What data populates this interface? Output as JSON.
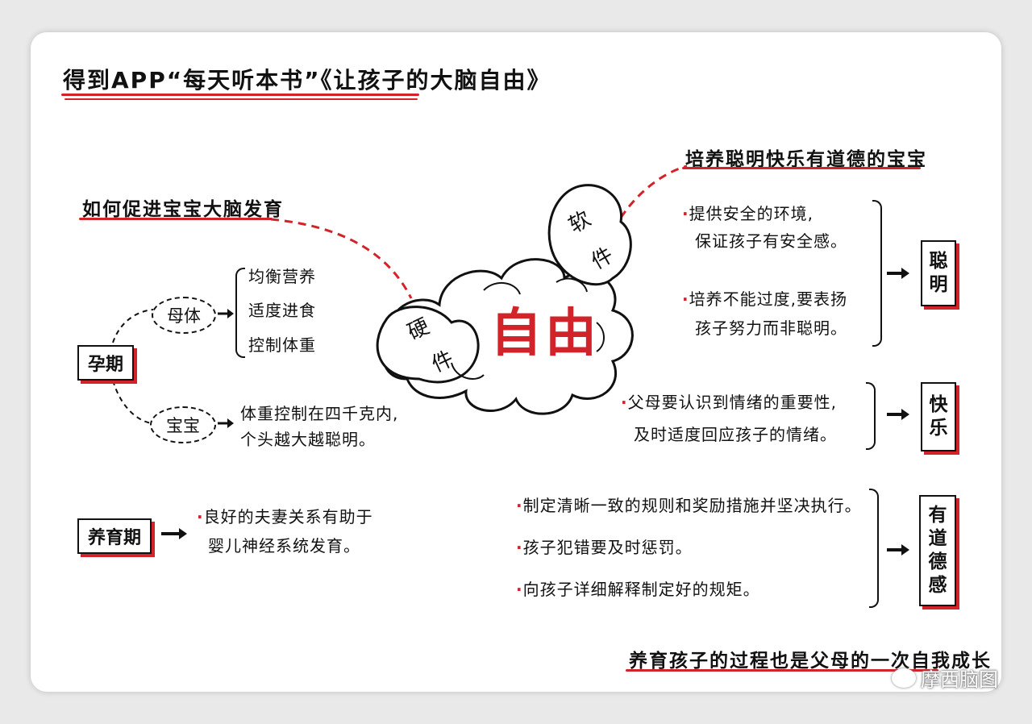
{
  "title": "得到APP“每天听本书”《让孩子的大脑自由》",
  "center": {
    "main": "自由",
    "hardware": [
      "硬",
      "件"
    ],
    "software": [
      "软",
      "件"
    ]
  },
  "left": {
    "heading": "如何促进宝宝大脑发育",
    "pregnancy": {
      "label": "孕期",
      "mother": {
        "label": "母体",
        "items": [
          "均衡营养",
          "适度进食",
          "控制体重"
        ]
      },
      "baby": {
        "label": "宝宝",
        "text": [
          "体重控制在四千克内,",
          "个头越大越聪明。"
        ]
      }
    },
    "nurturing": {
      "label": "养育期",
      "text": [
        "良好的夫妻关系有助于",
        "婴儿神经系统发育。"
      ]
    }
  },
  "right": {
    "heading": "培养聪明快乐有道德的宝宝",
    "smart": {
      "label": [
        "聪",
        "明"
      ],
      "items": [
        [
          "提供安全的环境,",
          "保证孩子有安全感。"
        ],
        [
          "培养不能过度,要表扬",
          "孩子努力而非聪明。"
        ]
      ]
    },
    "happy": {
      "label": [
        "快",
        "乐"
      ],
      "items": [
        [
          "父母要认识到情绪的重要性,",
          "及时适度回应孩子的情绪。"
        ]
      ]
    },
    "moral": {
      "label": [
        "有",
        "道",
        "德",
        "感"
      ],
      "items": [
        "制定清晰一致的规则和奖励措施并坚决执行。",
        "孩子犯错要及时惩罚。",
        "向孩子详细解释制定好的规矩。"
      ]
    }
  },
  "footer": "养育孩子的过程也是父母的一次自我成长",
  "watermark": "摩西脑图",
  "colors": {
    "accent": "#d2232a",
    "ink": "#111111",
    "background": "#e9e9e9"
  }
}
